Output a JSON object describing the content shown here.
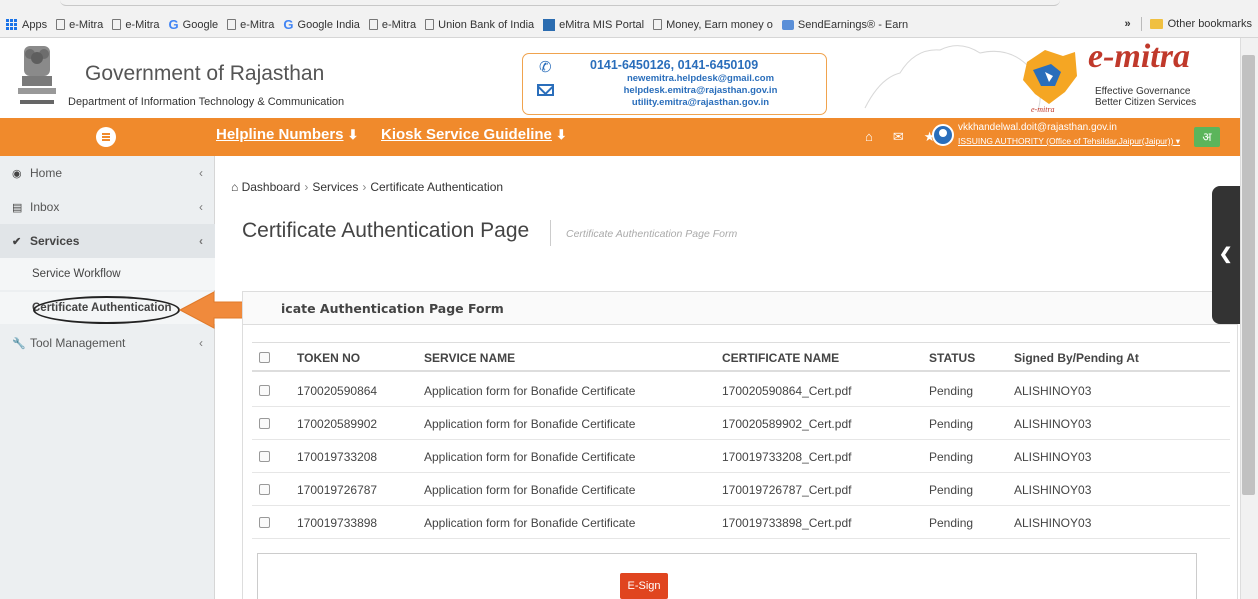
{
  "bookmarks": {
    "items": [
      {
        "icon": "apps-icon",
        "label": "Apps"
      },
      {
        "icon": "page-icon",
        "label": "e-Mitra"
      },
      {
        "icon": "page-icon",
        "label": "e-Mitra"
      },
      {
        "icon": "google-icon",
        "label": "Google"
      },
      {
        "icon": "page-icon",
        "label": "e-Mitra"
      },
      {
        "icon": "google-icon",
        "label": "Google India"
      },
      {
        "icon": "page-icon",
        "label": "e-Mitra"
      },
      {
        "icon": "page-icon",
        "label": "Union Bank of India"
      },
      {
        "icon": "emitra-icon",
        "label": "eMitra MIS Portal"
      },
      {
        "icon": "page-icon",
        "label": "Money, Earn money o"
      },
      {
        "icon": "sendearnings-icon",
        "label": "SendEarnings® - Earn"
      }
    ],
    "overflow": "»",
    "other": "Other bookmarks"
  },
  "header": {
    "title": "Government of Rajasthan",
    "department": "Department of Information Technology & Communication",
    "phone": "0141-6450126, 0141-6450109",
    "emails": [
      "newemitra.helpdesk@gmail.com",
      "helpdesk.emitra@rajasthan.gov.in",
      "utility.emitra@rajasthan.gov.in"
    ],
    "brand": "e-mitra",
    "tagline1": "Effective Governance",
    "tagline2": "Better Citizen Services"
  },
  "nav": {
    "helpline": "Helpline Numbers",
    "guideline": "Kiosk Service Guideline",
    "user_email": "vkkhandelwal.doit@rajasthan.gov.in",
    "user_role": "ISSUING AUTHORITY (Office of Tehsildar,Jaipur(Jaipur))",
    "lang": "अ"
  },
  "sidebar": {
    "items": [
      {
        "label": "Home",
        "icon": "dashboard-icon"
      },
      {
        "label": "Inbox",
        "icon": "inbox-icon"
      },
      {
        "label": "Services",
        "icon": "check-circle-icon"
      },
      {
        "label": "Tool Management",
        "icon": "wrench-icon"
      }
    ],
    "sub_items": [
      "Service Workflow",
      "Certificate Authentication"
    ]
  },
  "breadcrumb": [
    "Dashboard",
    "Services",
    "Certificate Authentication"
  ],
  "page": {
    "title": "Certificate Authentication Page",
    "subtitle": "Certificate Authentication Page Form",
    "panel_title": "icate Authentication Page Form"
  },
  "table": {
    "headers": [
      "TOKEN NO",
      "SERVICE NAME",
      "CERTIFICATE NAME",
      "STATUS",
      "Signed By/Pending At"
    ],
    "rows": [
      [
        "170020590864",
        "Application form for Bonafide Certificate",
        "170020590864_Cert.pdf",
        "Pending",
        "ALISHINOY03"
      ],
      [
        "170020589902",
        "Application form for Bonafide Certificate",
        "170020589902_Cert.pdf",
        "Pending",
        "ALISHINOY03"
      ],
      [
        "170019733208",
        "Application form for Bonafide Certificate",
        "170019733208_Cert.pdf",
        "Pending",
        "ALISHINOY03"
      ],
      [
        "170019726787",
        "Application form for Bonafide Certificate",
        "170019726787_Cert.pdf",
        "Pending",
        "ALISHINOY03"
      ],
      [
        "170019733898",
        "Application form for Bonafide Certificate",
        "170019733898_Cert.pdf",
        "Pending",
        "ALISHINOY03"
      ]
    ]
  },
  "actions": {
    "esign": "E-Sign"
  },
  "colors": {
    "accent": "#f08a2c",
    "brand_red": "#c0392b",
    "link_blue": "#2a6ebb",
    "esign": "#e0451f"
  }
}
